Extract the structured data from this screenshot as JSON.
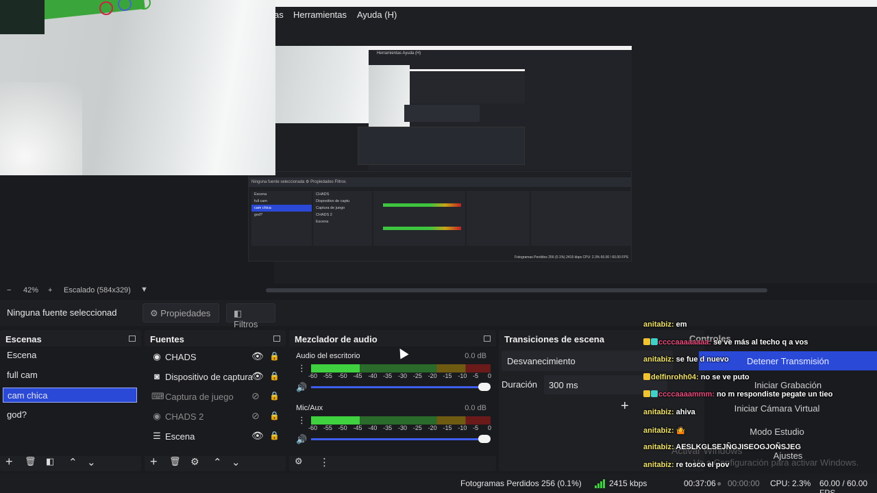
{
  "menubar": {
    "partial": "as",
    "tools": "Herramientas",
    "help": "Ayuda (H)"
  },
  "preview": {
    "nested_menu": "Herramientas    Ayuda (H)",
    "nested_header": "Ninguna fuente seleccionada     ⚙ Propiedades     Filtros",
    "nested_scenes": [
      "Escena",
      "full cam",
      "cam chica",
      "god?"
    ],
    "nested_sources": [
      "CHADS",
      "Dispositivo de captu",
      "Captura de juego",
      "CHADS 2",
      "Escena"
    ],
    "nested_status": "Fotogramas Perdidos 256 (0.1%)   2415 kbps   CPU: 2.3%   60.00 / 60.00 FPS"
  },
  "zoombar": {
    "minus": "−",
    "zoom": "42%",
    "plus": "+",
    "scale": "Escalado (584x329)",
    "dropdown": "▼"
  },
  "context": {
    "no_source": "Ninguna fuente seleccionad",
    "properties": "Propiedades",
    "filters": "Filtros"
  },
  "scenes": {
    "title": "Escenas",
    "items": [
      "Escena",
      "full cam",
      "cam chica",
      "god?"
    ],
    "selected_index": 2,
    "footer": {
      "add": "+",
      "remove": "🗑",
      "filter": "◧",
      "up": "⌃",
      "down": "⌄"
    }
  },
  "sources": {
    "title": "Fuentes",
    "items": [
      {
        "label": "CHADS",
        "icon": "browser-icon",
        "glyph": "◉",
        "visible": true
      },
      {
        "label": "Dispositivo de captura",
        "icon": "camera-icon",
        "glyph": "◙",
        "visible": true
      },
      {
        "label": "Captura de juego",
        "icon": "gamepad-icon",
        "glyph": "⌨",
        "visible": false
      },
      {
        "label": "CHADS 2",
        "icon": "browser-icon",
        "glyph": "◉",
        "visible": false
      },
      {
        "label": "Escena",
        "icon": "list-icon",
        "glyph": "☰",
        "visible": true
      }
    ],
    "footer": {
      "add": "+",
      "remove": "🗑",
      "settings": "⚙",
      "up": "⌃",
      "down": "⌄"
    }
  },
  "mixer": {
    "title": "Mezclador de audio",
    "channels": [
      {
        "name": "Audio del escritorio",
        "db": "0.0 dB",
        "level": 0.27
      },
      {
        "name": "Mic/Aux",
        "db": "0.0 dB",
        "level": 0.27
      }
    ],
    "ticks": [
      "-60",
      "-55",
      "-50",
      "-45",
      "-40",
      "-35",
      "-30",
      "-25",
      "-20",
      "-15",
      "-10",
      "-5",
      "0"
    ]
  },
  "transitions": {
    "title": "Transiciones de escena",
    "selected": "Desvanecimiento",
    "duration_label": "Duración",
    "duration": "300 ms",
    "add": "+"
  },
  "controls": {
    "title": "Controles",
    "stop_stream": "Detener Transmisión",
    "start_recording": "Iniciar Grabación",
    "virtual_cam": "Iniciar Cámara Virtual",
    "studio_mode": "Modo Estudio",
    "settings": "Ajustes"
  },
  "chat": [
    {
      "user": "anitabiz",
      "msg": "em",
      "badges": 0,
      "pink": false
    },
    {
      "user": "ccccaaaaaaaa",
      "msg": "se ve más al techo q a vos",
      "badges": 2,
      "pink": true
    },
    {
      "user": "anitabiz",
      "msg": "se fue d nuevo",
      "badges": 0,
      "pink": false
    },
    {
      "user": "delfinrohh04",
      "msg": "no se ve puto",
      "badges": 1,
      "pink": false
    },
    {
      "user": "ccccaaaammm",
      "msg": "no m respondiste pegate un tieo",
      "badges": 2,
      "pink": true
    },
    {
      "user": "anitabiz",
      "msg": "ahiva",
      "badges": 0,
      "pink": false
    },
    {
      "user": "anitabiz",
      "msg": "🤷",
      "badges": 0,
      "pink": false
    },
    {
      "user": "anitabiz",
      "msg": "AESLKGLSEJÑGJISEOGJOÑSJEG",
      "badges": 0,
      "pink": false
    },
    {
      "user": "anitabiz",
      "msg": "re tosco el pov",
      "badges": 0,
      "pink": false
    },
    {
      "user": "anitabiz",
      "msg": "🤷",
      "badges": 0,
      "pink": false
    }
  ],
  "watermark": {
    "line1": "Activar Windows",
    "line2": "Ve a Configuración para activar Windows."
  },
  "status": {
    "dropped": "Fotogramas Perdidos 256 (0.1%)",
    "bitrate": "2415 kbps",
    "live_time": "00:37:06",
    "rec_time": "00:00:00",
    "cpu": "CPU: 2.3%",
    "fps": "60.00 / 60.00 FPS"
  },
  "colors": {
    "accent": "#2a49d6",
    "meter_green": "#3fd13f",
    "bg": "#1a1b1f"
  }
}
